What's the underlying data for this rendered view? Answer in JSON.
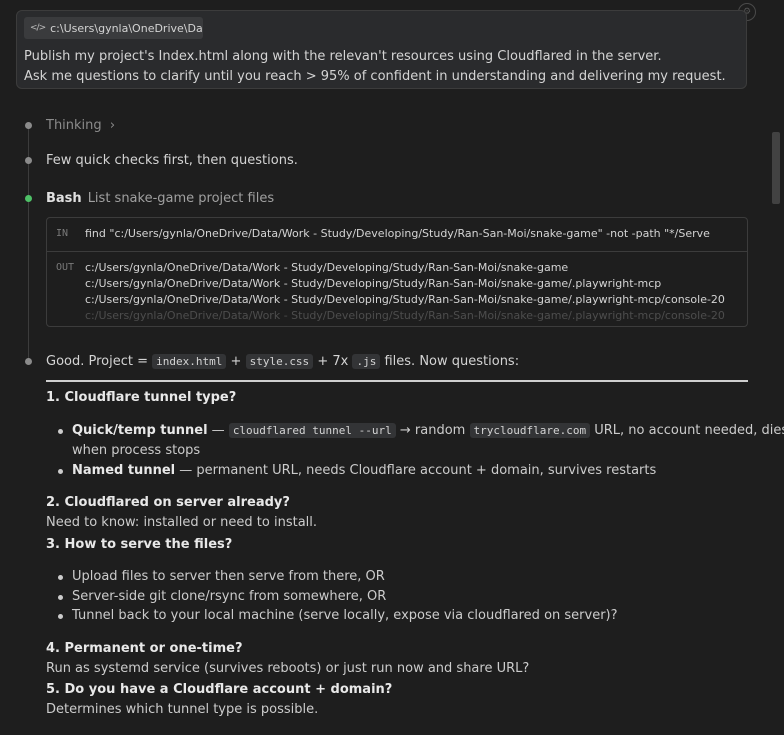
{
  "prompt": {
    "file_chip": "c:\\Users\\gynla\\OneDrive\\Da...",
    "line1": "Publish my project's Index.html along with the relevan't resources using Cloudflared in the server.",
    "line2": "Ask me questions to clarify until you reach > 95% of confident in understanding and delivering my request."
  },
  "timeline": {
    "thinking": "Thinking",
    "thinking_chevron": "›",
    "intro": "Few quick checks first, then questions.",
    "bash_label": "Bash",
    "bash_desc": "List snake-game project files"
  },
  "terminal": {
    "in_tag": "IN",
    "in_cmd": "find \"c:/Users/gynla/OneDrive/Data/Work - Study/Developing/Study/Ran-San-Moi/snake-game\" -not -path \"*/Serve",
    "out_tag": "OUT",
    "out_lines": [
      "c:/Users/gynla/OneDrive/Data/Work - Study/Developing/Study/Ran-San-Moi/snake-game",
      "c:/Users/gynla/OneDrive/Data/Work - Study/Developing/Study/Ran-San-Moi/snake-game/.playwright-mcp",
      "c:/Users/gynla/OneDrive/Data/Work - Study/Developing/Study/Ran-San-Moi/snake-game/.playwright-mcp/console-20",
      "c:/Users/gynla/OneDrive/Data/Work - Study/Developing/Study/Ran-San-Moi/snake-game/.playwright-mcp/console-20"
    ]
  },
  "summary": {
    "prefix": "Good. Project =",
    "file1": "index.html",
    "plus1": "+",
    "file2": "style.css",
    "plus2": "+ 7x",
    "file3": ".js",
    "suffix": "files. Now questions:"
  },
  "questions": {
    "q1": {
      "title": "1. Cloudflare tunnel type?",
      "b1_bold": "Quick/temp tunnel",
      "b1_dash": "—",
      "b1_code": "cloudflared tunnel --url",
      "b1_arrow": "→ random",
      "b1_code2": "trycloudflare.com",
      "b1_rest": "URL, no account needed, dies",
      "b1_wrap": "when process stops",
      "b2_bold": "Named tunnel",
      "b2_rest": "— permanent URL, needs Cloudflare account + domain, survives restarts"
    },
    "q2": {
      "title": "2. Cloudflared on server already?",
      "text": "Need to know: installed or need to install."
    },
    "q3": {
      "title": "3. How to serve the files?",
      "items": [
        "Upload files to server then serve from there, OR",
        "Server-side git clone/rsync from somewhere, OR",
        "Tunnel back to your local machine (serve locally, expose via cloudflared on server)?"
      ]
    },
    "q4": {
      "title": "4. Permanent or one-time?",
      "text": "Run as systemd service (survives reboots) or just run now and share URL?"
    },
    "q5": {
      "title": "5. Do you have a Cloudflare account + domain?",
      "text": "Determines which tunnel type is possible."
    }
  },
  "colors": {
    "background": "#1e1e1e",
    "accent_green": "#4ec167",
    "text": "#cccccc"
  }
}
